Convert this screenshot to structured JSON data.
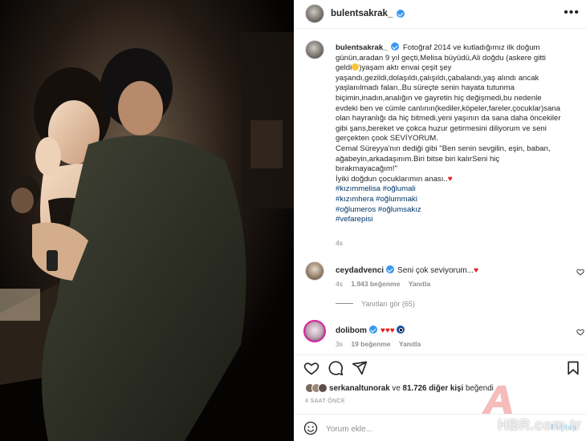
{
  "post": {
    "username": "bulentsakrak_",
    "more_icon": "more-horizontal-icon"
  },
  "caption": {
    "username": "bulentsakrak_",
    "lines": [
      "Fotoğraf 2014 ve kutladığımız ilk doğum",
      "günün,aradan 9 yıl geçti,Melisa büyüdü,Ali doğdu (askere gitti",
      ")yaşam aktı envai çeşit şey",
      "yaşandı,gezildi,dolaşıldı,çalışıldı,çabalandı,yaş alındı ancak",
      "yaşlanılmadı falan..Bu süreçte senin hayata tutunma",
      "biçimin,inadın,analığın ve gayretin hiç değişmedi,bu nedenle",
      "evdeki ben ve cümle canlının(kediler,köpeler,fareler,çocuklar)sana",
      "olan hayranlığı da hiç bitmedi,yeni yaşının da sana daha öncekiler",
      "gibi şans,bereket ve çokca huzur getirmesini diliyorum ve seni",
      "gerçekten çook SEVİYORUM.",
      "Cemal Süreyya'nın dediği gibi \"Ben senin sevgilin, eşin, baban,",
      "ağabeyin,arkadaşınım.Biri bitse biri kalırSeni hiç",
      "bırakmayacağım!\"",
      "İyiki doğdun çocuklarımın anası.."
    ],
    "line3_prefix": "geldi",
    "hashtags": [
      "#kızımmelisa #oğlumali",
      "#kızımhera #oğlummaki",
      "#oğlumeros #oğlumsakız",
      "#vefarepisi"
    ],
    "time": "4s"
  },
  "comments": [
    {
      "username": "ceydadvenci",
      "text": "Seni çok seviyorum...",
      "time": "4s",
      "likes": "1.943 beğenme",
      "reply": "Yanıtla",
      "verified": true
    },
    {
      "username": "dolibom",
      "text": "",
      "time": "3s",
      "likes": "19 beğenme",
      "reply": "Yanıtla",
      "verified": true
    }
  ],
  "replies_label": "Yanıtları gör (65)",
  "likes": {
    "first_user": "serkanaltunorak",
    "connector": "ve",
    "others": "81.726 diğer kişi",
    "suffix": "beğendi"
  },
  "posted_time": "4 SAAT ÖNCE",
  "add_comment": {
    "placeholder": "Yorum ekle...",
    "post_label": "Paylaş"
  },
  "watermark": "HBR.com.tr",
  "colors": {
    "verified": "#3897f0",
    "heart": "#e0201c",
    "hashtag": "#00376b",
    "meta": "#8e8e8e"
  }
}
